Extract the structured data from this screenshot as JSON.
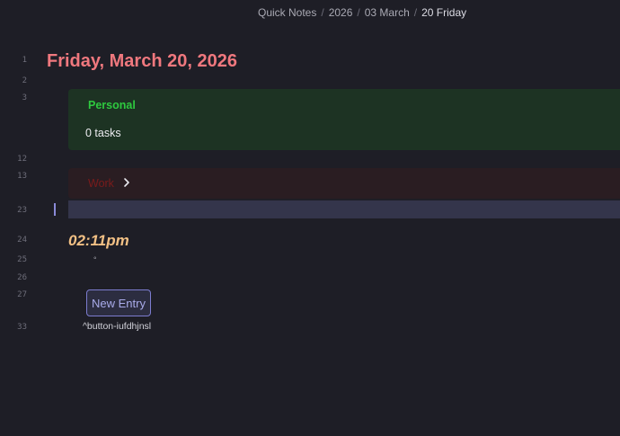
{
  "breadcrumb": {
    "items": [
      "Quick Notes",
      "2026",
      "03 March"
    ],
    "current": "20 Friday",
    "separator": "/"
  },
  "gutter": {
    "line_numbers": [
      "1",
      "2",
      "3",
      "12",
      "13",
      "23",
      "24",
      "25",
      "26",
      "27",
      "33"
    ]
  },
  "note": {
    "title": "Friday, March 20, 2026",
    "personal_callout": {
      "title": "Personal",
      "body": "0 tasks"
    },
    "work_callout": {
      "title": "Work"
    },
    "time_heading": "02:11pm",
    "bullet": "◦",
    "new_entry_button": "New Entry",
    "block_id": "^button-iufdhjnsl"
  },
  "colors": {
    "background": "#1e1e26",
    "title": "#f0787e",
    "personal_title": "#2ec93f",
    "personal_bg": "#1d3323",
    "work_title": "#7a1b1b",
    "work_bg": "#2a1d22",
    "time_heading": "#f3c185",
    "button_accent": "#7c7ccf",
    "active_line": "#34354b"
  },
  "icons": {
    "work_callout_fold": "chevron-right-icon"
  }
}
